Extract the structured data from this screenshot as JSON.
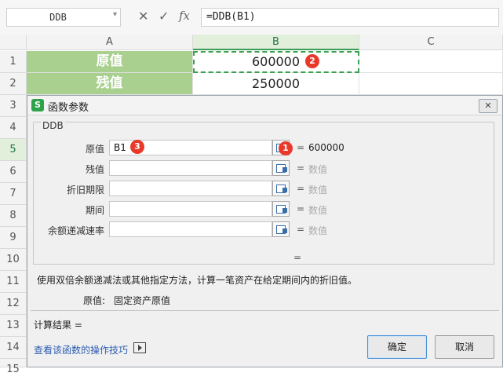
{
  "formula_bar": {
    "name_box": "DDB",
    "cancel_icon": "✕",
    "confirm_icon": "✓",
    "function_icon": "fx",
    "formula": "=DDB(B1)"
  },
  "sheet": {
    "columns": [
      "A",
      "B",
      "C"
    ],
    "selected_column": "B",
    "rows": [
      "1",
      "2",
      "3",
      "4",
      "5",
      "6",
      "7",
      "8",
      "9",
      "10",
      "11",
      "12",
      "13",
      "14",
      "15"
    ],
    "selected_row": "5",
    "cells": {
      "A1": "原值",
      "B1": "600000",
      "A2": "残值",
      "B2": "250000"
    }
  },
  "badges": {
    "one": "1",
    "two": "2",
    "three": "3"
  },
  "colors": {
    "accent_green": "#2ea24a",
    "label_fill": "#a9d08e",
    "badge_red": "#e8392b",
    "link_blue": "#2c5db0"
  },
  "dialog": {
    "title": "函数参数",
    "close_icon": "✕",
    "function_name": "DDB",
    "args": [
      {
        "label": "原值",
        "value": "B1",
        "equals": "=",
        "result": "600000"
      },
      {
        "label": "残值",
        "value": "",
        "equals": "=",
        "result": "数值"
      },
      {
        "label": "折旧期限",
        "value": "",
        "equals": "=",
        "result": "数值"
      },
      {
        "label": "期间",
        "value": "",
        "equals": "=",
        "result": "数值"
      },
      {
        "label": "余额递减速率",
        "value": "",
        "equals": "=",
        "result": "数值"
      }
    ],
    "formula_result_eq": "=",
    "description": "使用双倍余额递减法或其他指定方法，计算一笔资产在给定期间内的折旧值。",
    "arg_help_label": "原值:",
    "arg_help_text": "固定资产原值",
    "calc_result_label": "计算结果 =",
    "help_link": "查看该函数的操作技巧",
    "ok": "确定",
    "cancel": "取消"
  }
}
